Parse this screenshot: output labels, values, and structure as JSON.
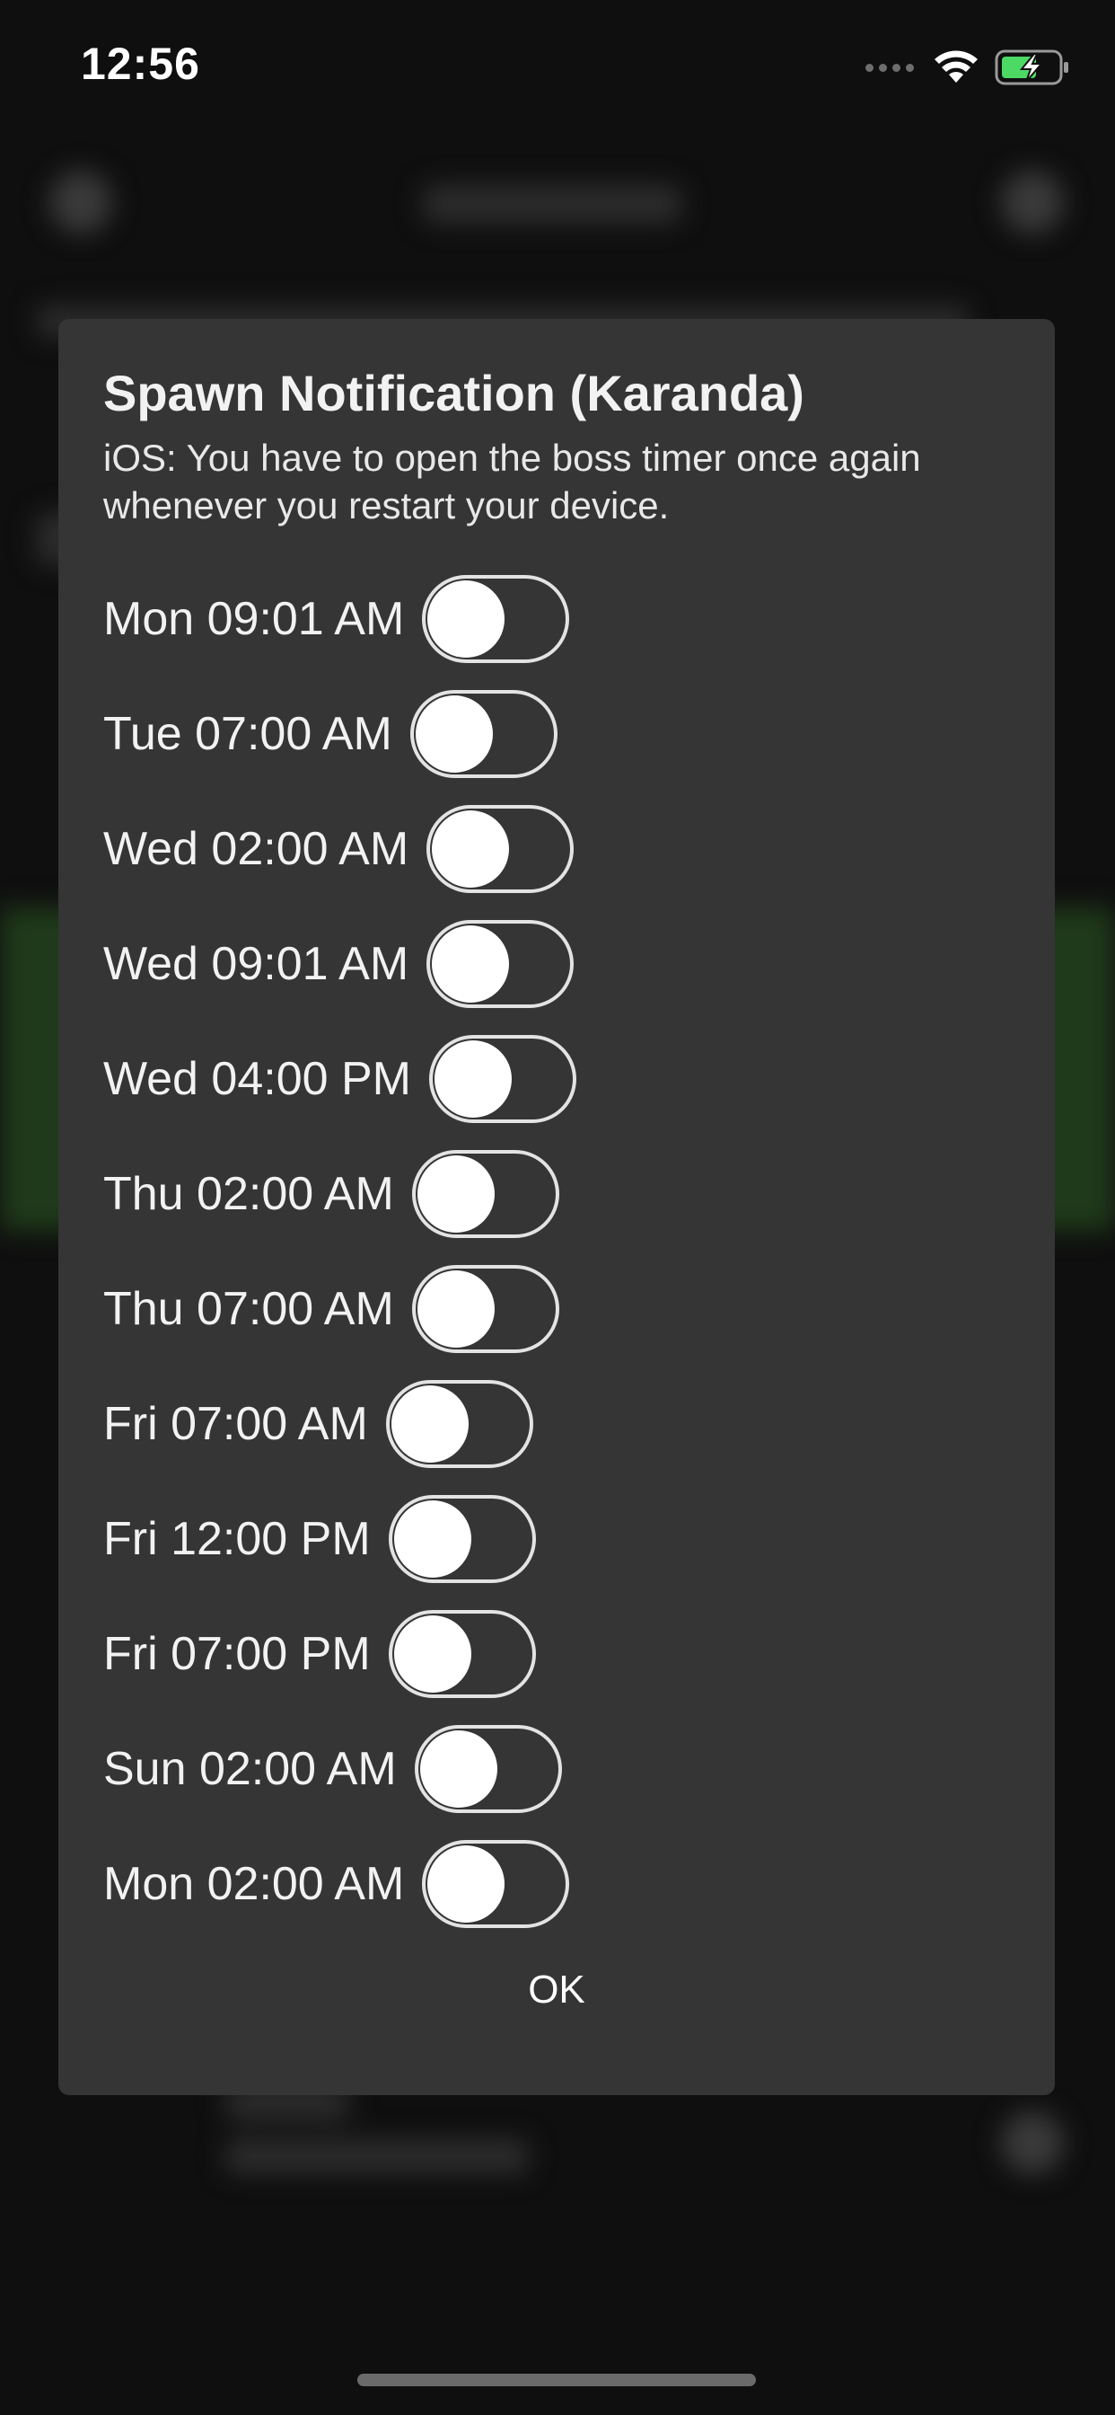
{
  "status_bar": {
    "time": "12:56"
  },
  "dialog": {
    "title": "Spawn Notification (Karanda)",
    "note": "iOS: You have to open the boss timer once again whenever you restart your device.",
    "schedule": [
      {
        "label": "Mon 09:01 AM",
        "enabled": false
      },
      {
        "label": "Tue 07:00 AM",
        "enabled": false
      },
      {
        "label": "Wed 02:00 AM",
        "enabled": false
      },
      {
        "label": "Wed 09:01 AM",
        "enabled": false
      },
      {
        "label": "Wed 04:00 PM",
        "enabled": false
      },
      {
        "label": "Thu 02:00 AM",
        "enabled": false
      },
      {
        "label": "Thu 07:00 AM",
        "enabled": false
      },
      {
        "label": "Fri 07:00 AM",
        "enabled": false
      },
      {
        "label": "Fri 12:00 PM",
        "enabled": false
      },
      {
        "label": "Fri 07:00 PM",
        "enabled": false
      },
      {
        "label": "Sun 02:00 AM",
        "enabled": false
      },
      {
        "label": "Mon 02:00 AM",
        "enabled": false
      }
    ],
    "ok_label": "OK"
  },
  "colors": {
    "dialog_background": "#353535",
    "battery_accent": "#4cd964",
    "toggle_on": "#34c759"
  },
  "icons": {
    "signal": "cellular-signal-icon",
    "wifi": "wifi-icon",
    "battery": "battery-charging-icon"
  }
}
